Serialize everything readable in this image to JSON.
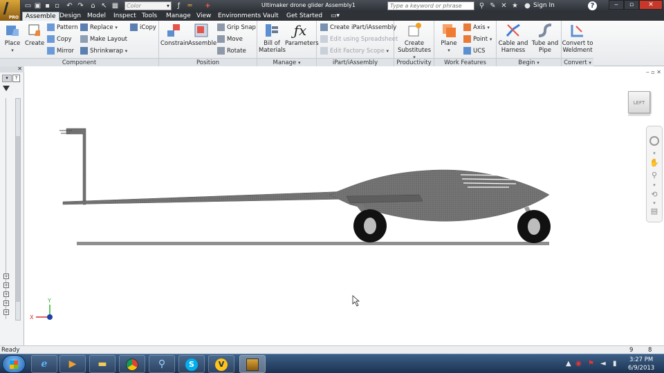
{
  "title_bar": {
    "title": "Ultimaker drone glider Assembly1",
    "color_combo": "Color",
    "search_placeholder": "Type a keyword or phrase",
    "sign_in": "Sign In",
    "help": "?",
    "pro_badge": "PRO"
  },
  "tabs": [
    "Assemble",
    "Design",
    "Model",
    "Inspect",
    "Tools",
    "Manage",
    "View",
    "Environments",
    "Vault",
    "Get Started"
  ],
  "ribbon": {
    "component": {
      "title": "Component",
      "place": "Place",
      "create": "Create",
      "pattern": "Pattern",
      "copy": "Copy",
      "mirror": "Mirror",
      "replace": "Replace",
      "make_layout": "Make Layout",
      "shrinkwrap": "Shrinkwrap",
      "icopy": "iCopy"
    },
    "position": {
      "title": "Position",
      "constrain": "Constrain",
      "assemble": "Assemble",
      "grip_snap": "Grip Snap",
      "move": "Move",
      "rotate": "Rotate"
    },
    "manage": {
      "title": "Manage",
      "bom_line1": "Bill of",
      "bom_line2": "Materials",
      "parameters": "Parameters"
    },
    "ipart": {
      "title": "iPart/iAssembly",
      "create": "Create iPart/iAssembly",
      "edit_spreadsheet": "Edit using Spreadsheet",
      "edit_factory": "Edit Factory Scope"
    },
    "productivity": {
      "title": "Productivity",
      "create_subs_line1": "Create",
      "create_subs_line2": "Substitutes"
    },
    "work_features": {
      "title": "Work Features",
      "plane": "Plane",
      "axis": "Axis",
      "point": "Point",
      "ucs": "UCS"
    },
    "begin": {
      "title": "Begin",
      "cable_line1": "Cable and",
      "cable_line2": "Harness",
      "tube_line1": "Tube and",
      "tube_line2": "Pipe"
    },
    "convert": {
      "title": "Convert",
      "weld_line1": "Convert to",
      "weld_line2": "Weldment"
    }
  },
  "viewcube_label": "LEFT",
  "axis_labels": {
    "x": "X",
    "y": "Y"
  },
  "status": {
    "text": "Ready",
    "count1": "9",
    "count2": "8"
  },
  "taskbar": {
    "time": "3:27 PM",
    "date": "6/9/2013"
  }
}
